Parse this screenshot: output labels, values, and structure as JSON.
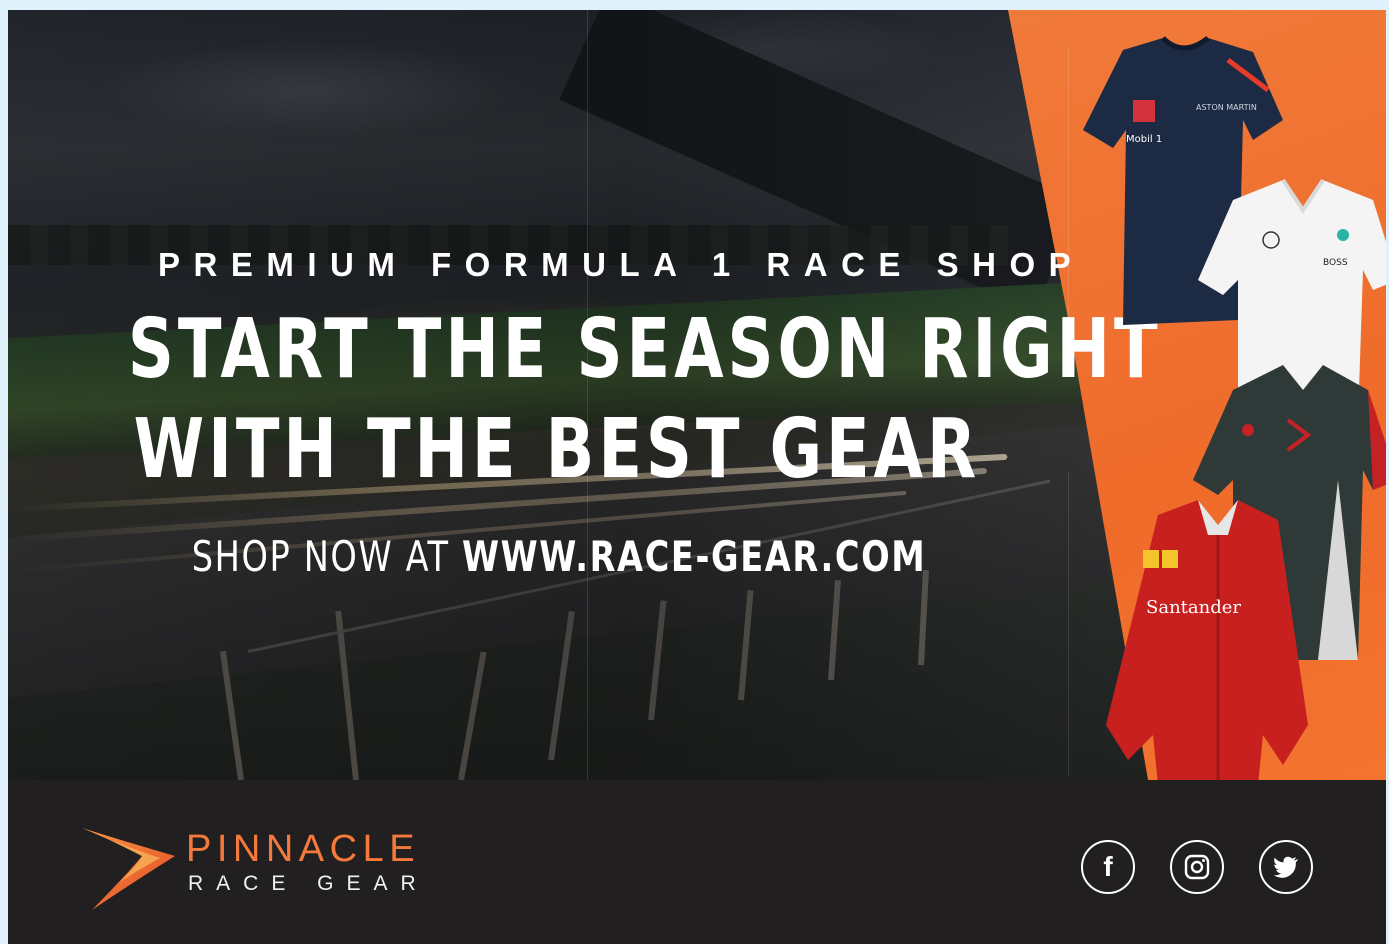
{
  "banner": {
    "kicker": "PREMIUM FORMULA 1 RACE SHOP",
    "headline_line1": "START THE SEASON RIGHT",
    "headline_line2": "WITH THE BEST GEAR",
    "cta_prefix": "SHOP NOW AT",
    "cta_url": "WWW.RACE-GEAR.COM",
    "accent_color": "#ef6b2a"
  },
  "products": [
    {
      "icon": "navy-team-tshirt",
      "color": "#1d2a44"
    },
    {
      "icon": "white-team-polo",
      "color": "#f4f4f4"
    },
    {
      "icon": "dark-grey-team-polo",
      "color": "#2f3a38"
    },
    {
      "icon": "red-team-jacket",
      "color": "#c8201e",
      "label": "Santander"
    }
  ],
  "footer": {
    "brand_name": "PINNACLE",
    "brand_sub": "RACE GEAR",
    "brand_color": "#f37a3c",
    "background": "#221f20",
    "social": [
      {
        "icon": "facebook-icon",
        "label": "f"
      },
      {
        "icon": "instagram-icon"
      },
      {
        "icon": "twitter-icon"
      }
    ]
  }
}
